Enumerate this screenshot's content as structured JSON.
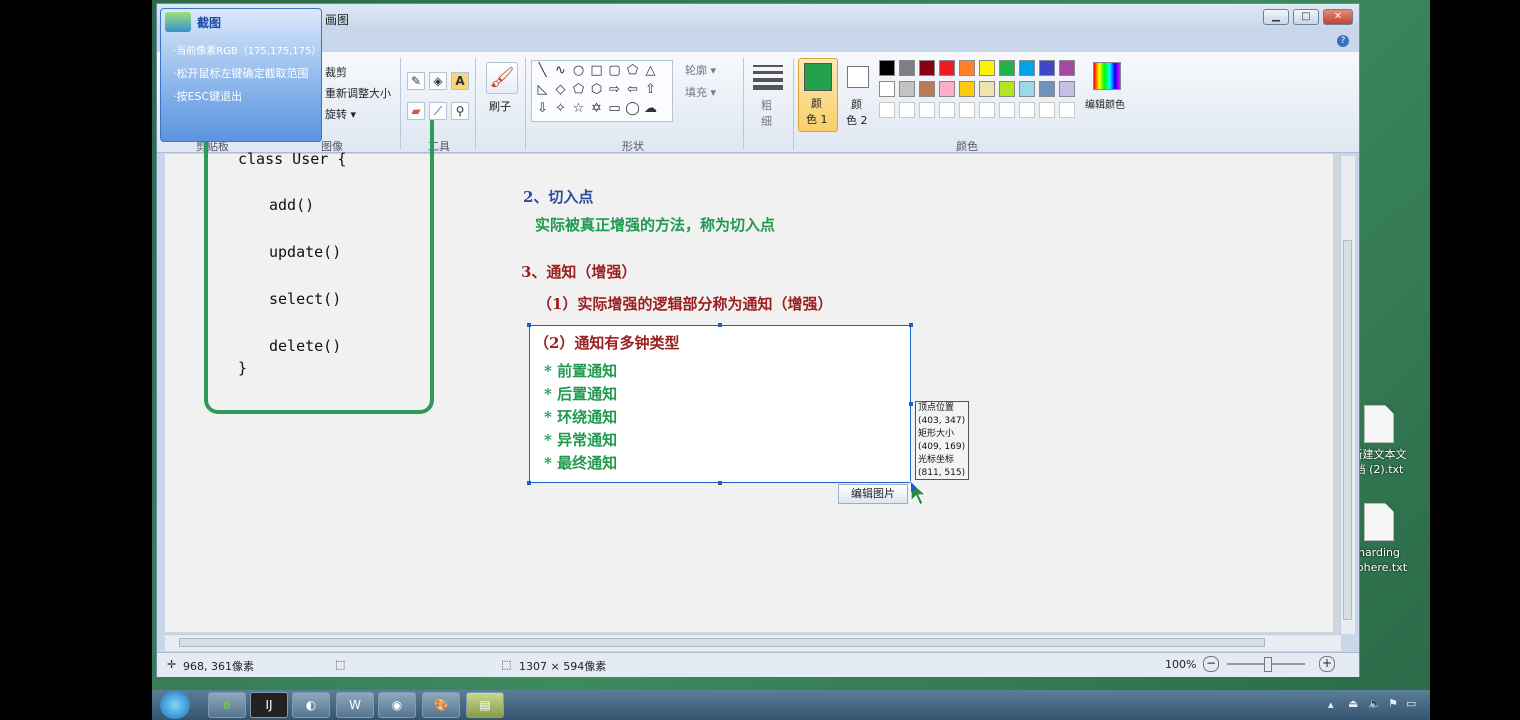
{
  "window": {
    "title": "画图"
  },
  "snip_tool": {
    "title": "截图",
    "lines": [
      "·当前像素RGB（175,175,175）",
      "·松开鼠标左键确定截取范围",
      "·按ESC键退出"
    ]
  },
  "ribbon": {
    "clipboard_label": "剪贴板",
    "image": {
      "crop": "裁剪",
      "resize": "重新调整大小",
      "rotate": "旋转 ▾",
      "group": "图像"
    },
    "tools": {
      "group": "工具"
    },
    "brush": {
      "label": "刷子"
    },
    "shapes": {
      "group": "形状",
      "outline": "轮廓 ▾",
      "fill": "填充 ▾"
    },
    "size": {
      "label1": "粗",
      "label2": "细"
    },
    "colors": {
      "color1_label1": "颜",
      "color1_label2": "色 1",
      "color2_label1": "颜",
      "color2_label2": "色 2",
      "edit_colors": "编辑颜色",
      "group": "颜色",
      "row1": [
        "#000000",
        "#7f7f7f",
        "#880015",
        "#ed1c24",
        "#ff7f27",
        "#fff200",
        "#22b14c",
        "#00a2e8",
        "#3f48cc",
        "#a349a4"
      ],
      "row2": [
        "#ffffff",
        "#c3c3c3",
        "#b97a57",
        "#ffaec9",
        "#ffc90e",
        "#efe4b0",
        "#b5e61d",
        "#99d9ea",
        "#7092be",
        "#c8bfe7"
      ],
      "color1": "#22a04a",
      "color2": "#ffffff"
    }
  },
  "canvas": {
    "code": [
      "class User {",
      "add()",
      "update()",
      "select()",
      "delete()",
      "}"
    ],
    "point2_title": "2、切入点",
    "point2_desc": "实际被真正增强的方法，称为切入点",
    "point3_title": "3、通知（增强）",
    "point3_sub1": "（1）实际增强的逻辑部分称为通知（增强）",
    "point3_sub2": "（2）通知有多钟类型",
    "advice_types": [
      "*  前置通知",
      "*  后置通知",
      "*  环绕通知",
      "*  异常通知",
      "*  最终通知"
    ]
  },
  "coord_tooltip": {
    "lines": [
      "顶点位置",
      "(403, 347)",
      "矩形大小",
      "(409, 169)",
      "光标坐标",
      "(811, 515)"
    ]
  },
  "edit_image_button": "编辑图片",
  "statusbar": {
    "cursor_pos": "968, 361像素",
    "image_size": "1307 × 594像素",
    "zoom": "100%"
  },
  "desktop": {
    "icons": [
      {
        "line1": "新建文本文",
        "line2": "档 (2).txt"
      },
      {
        "line1": "harding",
        "line2": "sphere.txt"
      }
    ]
  },
  "taskbar": {
    "items": [
      "",
      "e",
      "IJ",
      "",
      "W",
      "",
      "",
      ""
    ]
  }
}
